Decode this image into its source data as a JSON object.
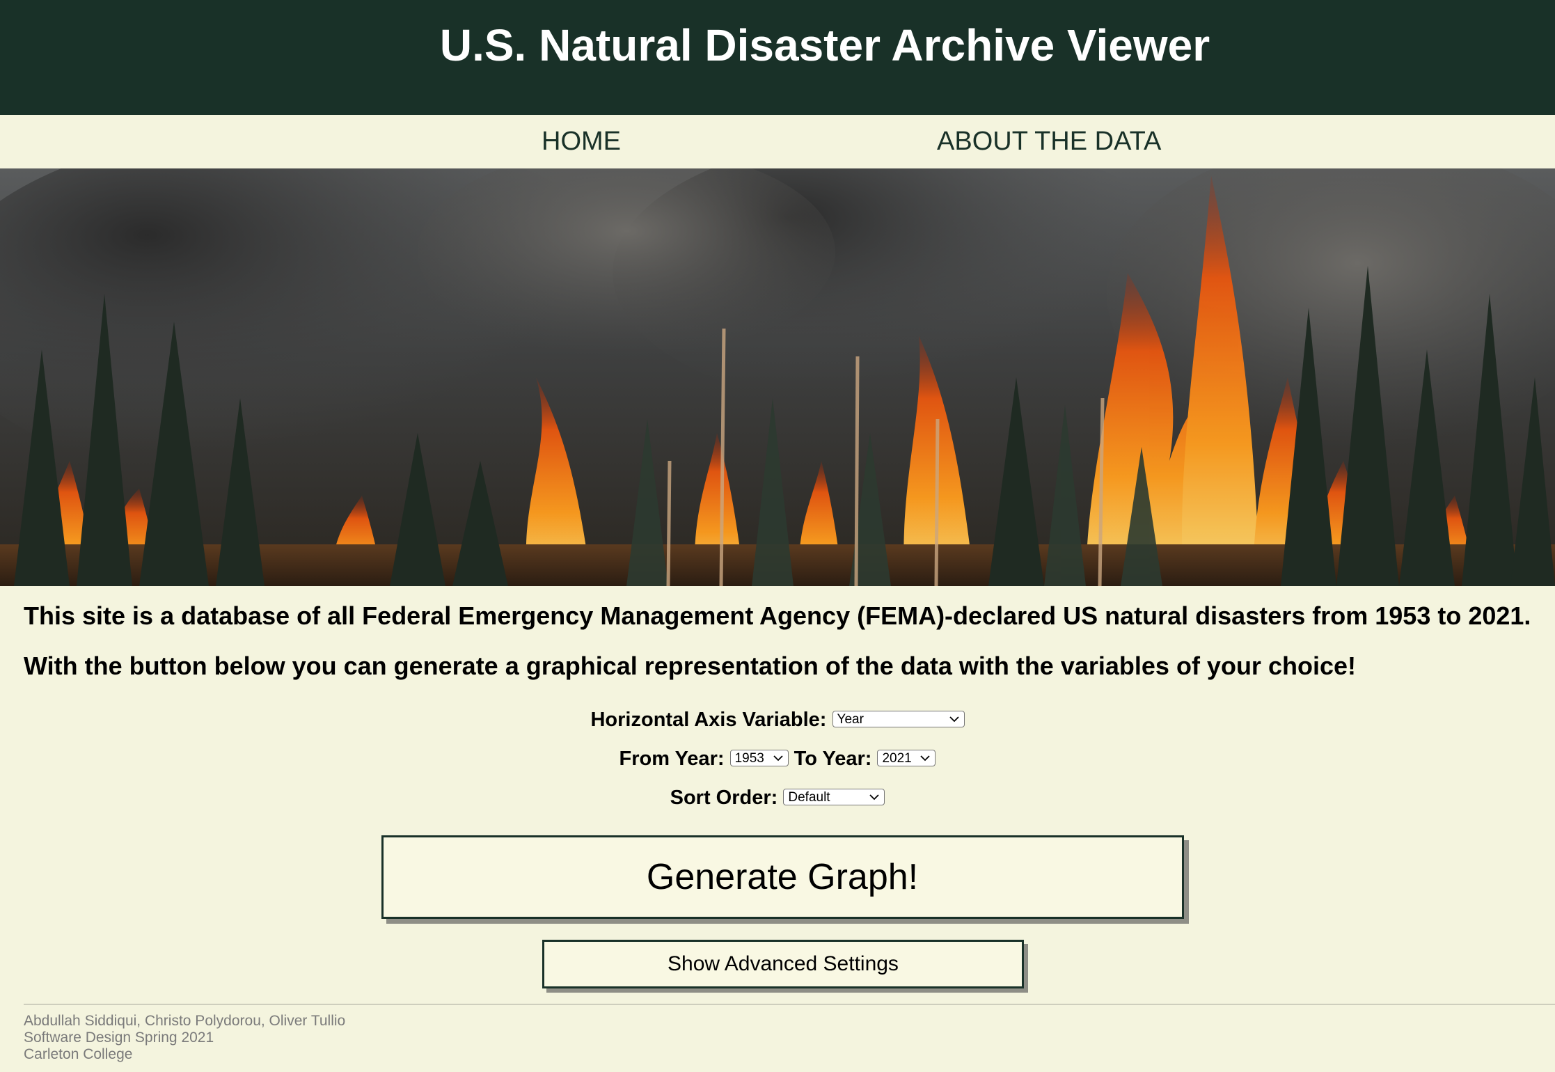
{
  "header": {
    "title": "U.S. Natural Disaster Archive Viewer"
  },
  "nav": {
    "home": "HOME",
    "about": "ABOUT THE DATA"
  },
  "hero": {
    "image_icon": "wildfire-forest-photo"
  },
  "intro": {
    "line1": "This site is a database of all Federal Emergency Management Agency (FEMA)-declared US natural disasters from 1953 to 2021.",
    "line2": "With the button below you can generate a graphical representation of the data with the variables of your choice!"
  },
  "controls": {
    "axis_label": "Horizontal Axis Variable:",
    "axis_value": "Year",
    "from_label": "From Year:",
    "from_value": "1953",
    "to_label": "To Year:",
    "to_value": "2021",
    "sort_label": "Sort Order:",
    "sort_value": "Default"
  },
  "buttons": {
    "generate": "Generate Graph!",
    "advanced": "Show Advanced Settings"
  },
  "footer": {
    "authors": "Abdullah Siddiqui, Christo Polydorou, Oliver Tullio",
    "course": "Software Design Spring 2021",
    "school": "Carleton College"
  },
  "colors": {
    "header_bg": "#193128",
    "page_bg": "#f4f4de",
    "button_bg": "#f9f8e3",
    "button_border": "#193128",
    "footer_text": "#7a7a7a"
  }
}
